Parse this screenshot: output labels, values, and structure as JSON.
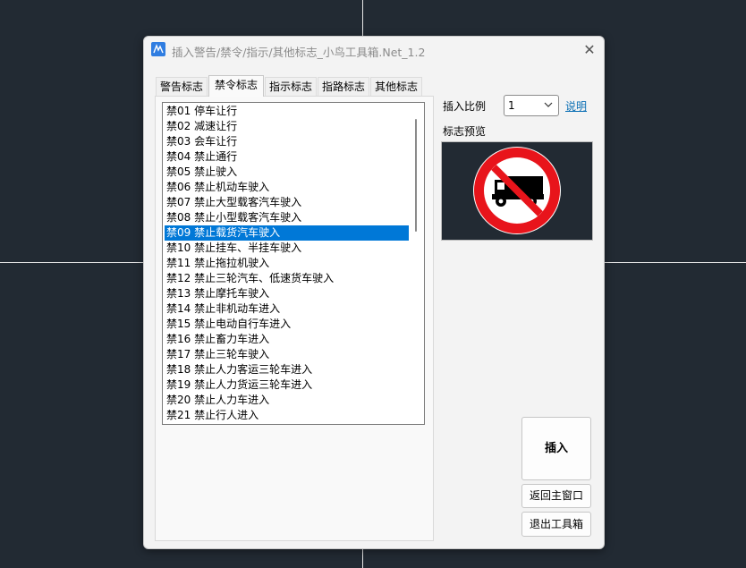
{
  "window": {
    "title": "插入警告/禁令/指示/其他标志_小鸟工具箱.Net_1.2"
  },
  "tabs": [
    {
      "label": "警告标志"
    },
    {
      "label": "禁令标志"
    },
    {
      "label": "指示标志"
    },
    {
      "label": "指路标志"
    },
    {
      "label": "其他标志"
    }
  ],
  "active_tab": "禁令标志",
  "list": {
    "items": [
      "禁01 停车让行",
      "禁02 减速让行",
      "禁03 会车让行",
      "禁04 禁止通行",
      "禁05 禁止驶入",
      "禁06 禁止机动车驶入",
      "禁07 禁止大型载客汽车驶入",
      "禁08 禁止小型载客汽车驶入",
      "禁09 禁止载货汽车驶入",
      "禁10 禁止挂车、半挂车驶入",
      "禁11 禁止拖拉机驶入",
      "禁12 禁止三轮汽车、低速货车驶入",
      "禁13 禁止摩托车驶入",
      "禁14 禁止非机动车进入",
      "禁15 禁止电动自行车进入",
      "禁16 禁止畜力车进入",
      "禁17 禁止三轮车驶入",
      "禁18 禁止人力客运三轮车进入",
      "禁19 禁止人力货运三轮车进入",
      "禁20 禁止人力车进入",
      "禁21 禁止行人进入"
    ],
    "selected_index": 8
  },
  "scale": {
    "label": "插入比例",
    "value": "1",
    "help_link": "说明"
  },
  "preview": {
    "label": "标志预览",
    "icon": "no-trucks-sign"
  },
  "buttons": {
    "insert": "插入",
    "back": "返回主窗口",
    "exit": "退出工具箱"
  },
  "colors": {
    "selection": "#0078d7",
    "sign_red": "#e8141b",
    "link": "#0a6fb4"
  }
}
